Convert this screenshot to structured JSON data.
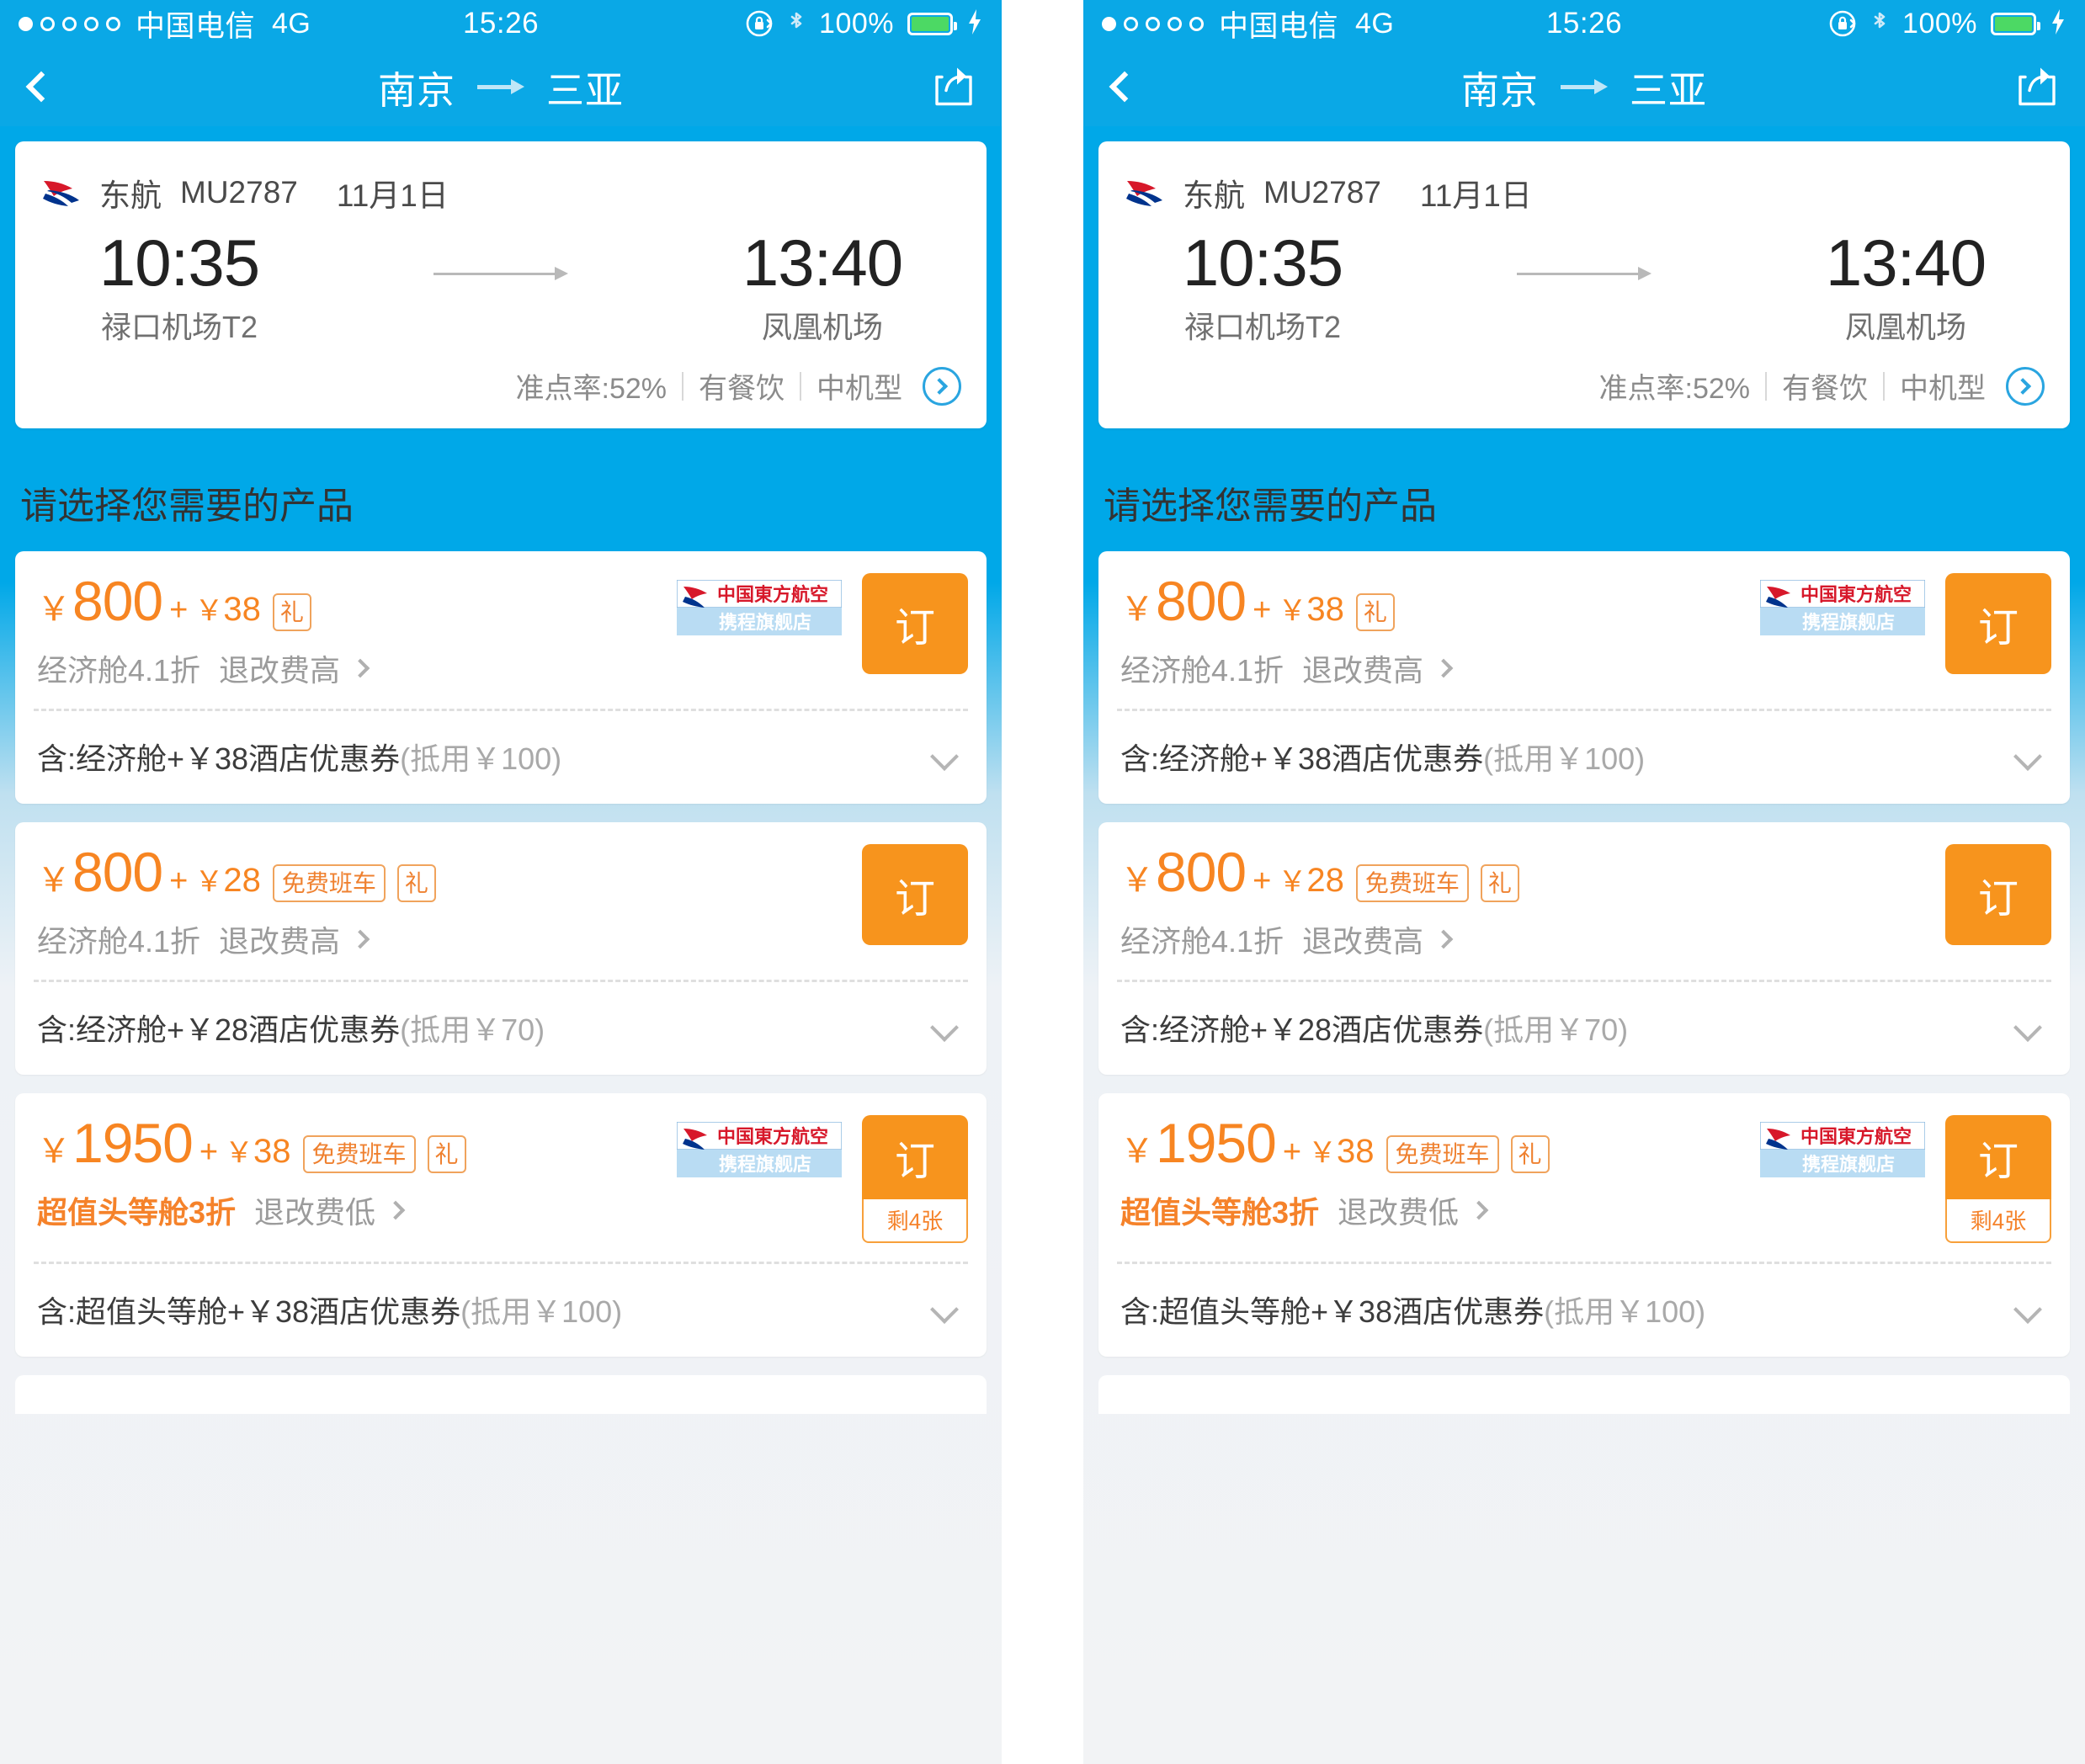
{
  "status_bar": {
    "signal_dots": [
      true,
      false,
      false,
      false,
      false
    ],
    "carrier": "中国电信",
    "network": "4G",
    "time": "15:26",
    "rotation_lock_icon": "rotation-lock-icon",
    "bluetooth_icon": "bluetooth-icon",
    "battery_percent": "100%",
    "charging_icon": "lightning-bolt-icon"
  },
  "nav": {
    "back_icon": "chevron-left-icon",
    "origin": "南京",
    "arrow_icon": "arrow-right-icon",
    "destination": "三亚",
    "share_icon": "share-icon"
  },
  "flight": {
    "airline_logo": "china-eastern-logo",
    "airline": "东航",
    "flight_no": "MU2787",
    "date": "11月1日",
    "depart_time": "10:35",
    "depart_airport": "禄口机场T2",
    "arrive_time": "13:40",
    "arrive_airport": "凤凰机场",
    "on_time_rate": "准点率:52%",
    "meal": "有餐饮",
    "aircraft": "中机型",
    "detail_chevron_icon": "chevron-right-circle-icon"
  },
  "section": {
    "title": "请选择您需要的产品"
  },
  "products": [
    {
      "currency": "￥",
      "price": "800",
      "plus": "+",
      "fee_currency": "￥",
      "fee": "38",
      "tags": [
        "礼"
      ],
      "has_flagship_badge": true,
      "flagship_badge_top": "中国東方航空",
      "flagship_badge_bottom": "携程旗舰店",
      "cabin": "经济舱4.1折",
      "cabin_highlight": false,
      "refund": "退改费高",
      "refund_chevron_icon": "chevron-right-icon",
      "book_label": "订",
      "left_count": "",
      "include_main": "含:经济舱+￥38酒店优惠券",
      "include_muted": "(抵用￥100)",
      "expand_icon": "chevron-down-icon"
    },
    {
      "currency": "￥",
      "price": "800",
      "plus": "+",
      "fee_currency": "￥",
      "fee": "28",
      "tags": [
        "免费班车",
        "礼"
      ],
      "has_flagship_badge": false,
      "flagship_badge_top": "",
      "flagship_badge_bottom": "",
      "cabin": "经济舱4.1折",
      "cabin_highlight": false,
      "refund": "退改费高",
      "refund_chevron_icon": "chevron-right-icon",
      "book_label": "订",
      "left_count": "",
      "include_main": "含:经济舱+￥28酒店优惠券",
      "include_muted": "(抵用￥70)",
      "expand_icon": "chevron-down-icon"
    },
    {
      "currency": "￥",
      "price": "1950",
      "plus": "+",
      "fee_currency": "￥",
      "fee": "38",
      "tags": [
        "免费班车",
        "礼"
      ],
      "has_flagship_badge": true,
      "flagship_badge_top": "中国東方航空",
      "flagship_badge_bottom": "携程旗舰店",
      "cabin": "超值头等舱3折",
      "cabin_highlight": true,
      "refund": "退改费低",
      "refund_chevron_icon": "chevron-right-icon",
      "book_label": "订",
      "left_count": "剩4张",
      "include_main": "含:超值头等舱+￥38酒店优惠券",
      "include_muted": "(抵用￥100)",
      "expand_icon": "chevron-down-icon"
    }
  ],
  "colors": {
    "brand_blue": "#0aa8e6",
    "accent_orange": "#f7941d",
    "price_orange": "#f78522",
    "battery_green": "#4cd964"
  }
}
